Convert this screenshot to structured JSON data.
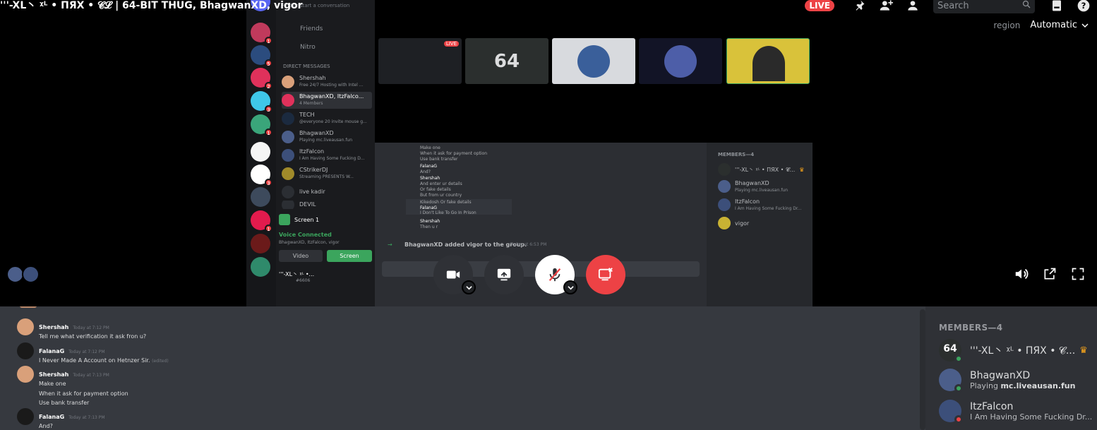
{
  "call": {
    "title": "'''-XL丶 ᵡᴸ • ПЯХ • 𝓒𝓛 | 64-BIT THUG, BhagwanXD, vigor",
    "live_label": "LIVE",
    "search_placeholder": "Search",
    "region_label": "region",
    "region_value": "Automatic"
  },
  "stream": {
    "search_conv": "Find or start a conversation",
    "friends": "Friends",
    "nitro": "Nitro",
    "dm_header": "DIRECT MESSAGES",
    "dms": [
      {
        "name": "Shershah",
        "sub": "Free 24/7 Hosting with Intel ..."
      },
      {
        "name": "BhagwanXD, ItzFalco...",
        "sub": "4 Members"
      },
      {
        "name": "TECH",
        "sub": "@everyone 20 invite mouse g..."
      },
      {
        "name": "BhagwanXD",
        "sub": "Playing mc.liveausan.fun"
      },
      {
        "name": "ItzFalcon",
        "sub": "I Am Having Some Fucking D..."
      },
      {
        "name": "CStrikerDJ",
        "sub": "Streaming PRESENTS W..."
      },
      {
        "name": "live kadir",
        "sub": ""
      },
      {
        "name": "DEVIL",
        "sub": ""
      }
    ],
    "screen_label": "Screen 1",
    "voice_connected": "Voice Connected",
    "voice_sub": "BhagwanXD, ItzFalcon, vigor",
    "video_btn": "Video",
    "screen_btn": "Screen",
    "user_name": "'''-XL丶 ᵡᴸ •...",
    "user_tag": "#6606",
    "tile_label": "64",
    "live_small": "LIVE",
    "chat_lines": [
      "Make one",
      "When it ask for payment option",
      "Use bank transfer",
      "FalanaG",
      "And?",
      "Shershah",
      "And enter ur details",
      "Or fake details",
      "But from ur country",
      "Kikedosh Or fake details",
      "FalanaG",
      "I Don't Like To Go In Prison",
      "Shershah",
      "Then u r"
    ],
    "added_msg": "BhagwanXD added vigor to the group.",
    "added_time": "Today at 6:53 PM",
    "members_header": "MEMBERS—4",
    "members": [
      {
        "name": "'''-XL丶 ᵡᴸ • ПЯХ • 𝓒...",
        "sub": ""
      },
      {
        "name": "BhagwanXD",
        "sub": "Playing mc.liveausan.fun"
      },
      {
        "name": "ItzFalcon",
        "sub": "I Am Having Some Fucking Dr..."
      },
      {
        "name": "vigor",
        "sub": ""
      }
    ]
  },
  "chat": {
    "messages": [
      {
        "author": "Shershah",
        "time": "Today at 7:12 PM",
        "lines": [
          "Tell me what verification it ask fron u?"
        ]
      },
      {
        "author": "FalanaG",
        "time": "Today at 7:12 PM",
        "lines": [
          "I Never Made A Account on Hetnzer Sir."
        ],
        "edited": "(edited)"
      },
      {
        "author": "Shershah",
        "time": "Today at 7:13 PM",
        "lines": [
          "Make one",
          "When it ask for payment option",
          "Use bank transfer"
        ]
      },
      {
        "author": "FalanaG",
        "time": "Today at 7:13 PM",
        "lines": [
          "And?"
        ]
      }
    ]
  },
  "members": {
    "header": "MEMBERS—4",
    "list": [
      {
        "name": "'''-XL丶 ᵡᴸ • ПЯХ • 𝓒...",
        "sub_prefix": "",
        "sub_bold": "",
        "status": "online",
        "crown": true
      },
      {
        "name": "BhagwanXD",
        "sub_prefix": "Playing ",
        "sub_bold": "mc.liveausan.fun",
        "status": "online",
        "crown": false
      },
      {
        "name": "ItzFalcon",
        "sub_prefix": "I Am Having Some Fucking Dr...",
        "sub_bold": "",
        "status": "dnd",
        "crown": false
      }
    ]
  },
  "colors": {
    "live": "#ed4245",
    "online": "#3ba55d",
    "dnd": "#ed4245",
    "accent_green": "#3ba55d",
    "crown": "#faa61a"
  }
}
